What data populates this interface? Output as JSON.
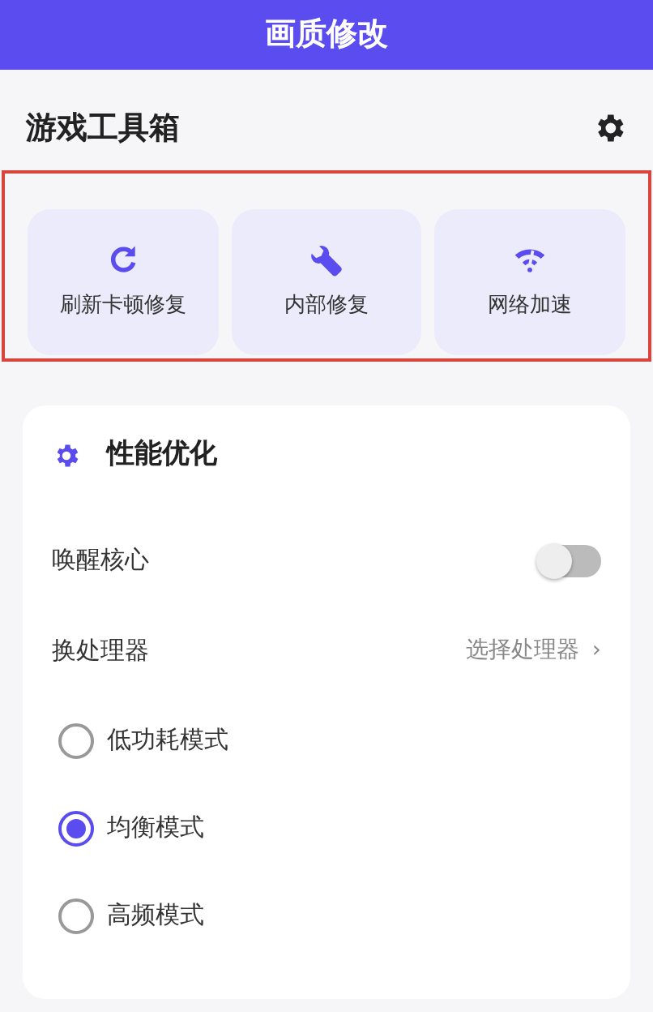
{
  "header": {
    "title": "画质修改"
  },
  "toolbox": {
    "title": "游戏工具箱",
    "highlighted": true,
    "tools": [
      {
        "label": "刷新卡顿修复"
      },
      {
        "label": "内部修复"
      },
      {
        "label": "网络加速"
      }
    ]
  },
  "performance": {
    "title": "性能优化",
    "rows": [
      {
        "kind": "switch",
        "label": "唤醒核心",
        "on": false
      },
      {
        "kind": "link",
        "label": "换处理器",
        "value": "选择处理器",
        "chevron": "›"
      }
    ],
    "modes": [
      {
        "label": "低功耗模式",
        "selected": false
      },
      {
        "label": "均衡模式",
        "selected": true
      },
      {
        "label": "高频模式",
        "selected": false
      }
    ]
  }
}
